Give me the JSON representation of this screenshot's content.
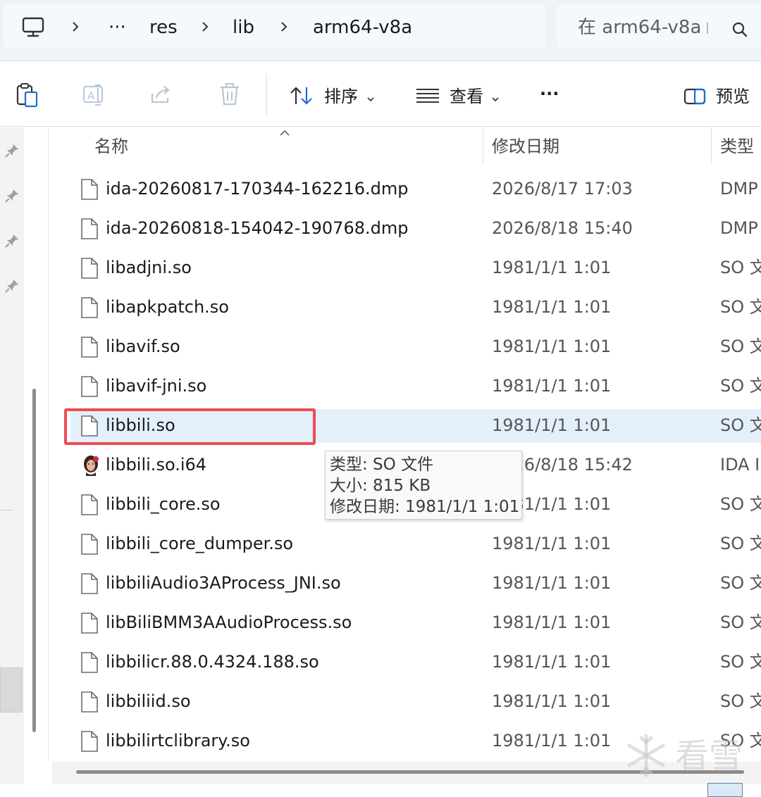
{
  "address_bar": {
    "breadcrumbs": [
      "res",
      "lib",
      "arm64-v8a"
    ],
    "overflow": "···"
  },
  "search": {
    "placeholder": "在 arm64-v8a"
  },
  "toolbar": {
    "sort_label": "排序",
    "view_label": "查看",
    "more_label": "···",
    "preview_label": "预览"
  },
  "columns": {
    "name": "名称",
    "modified": "修改日期",
    "type": "类型"
  },
  "files": [
    {
      "name": "ida-20260817-170344-162216.dmp",
      "modified": "2026/8/17 17:03",
      "type": "DMP",
      "icon": "file-icon"
    },
    {
      "name": "ida-20260818-154042-190768.dmp",
      "modified": "2026/8/18 15:40",
      "type": "DMP",
      "icon": "file-icon"
    },
    {
      "name": "libadjni.so",
      "modified": "1981/1/1 1:01",
      "type": "SO 文",
      "icon": "file-icon"
    },
    {
      "name": "libapkpatch.so",
      "modified": "1981/1/1 1:01",
      "type": "SO 文",
      "icon": "file-icon"
    },
    {
      "name": "libavif.so",
      "modified": "1981/1/1 1:01",
      "type": "SO 文",
      "icon": "file-icon"
    },
    {
      "name": "libavif-jni.so",
      "modified": "1981/1/1 1:01",
      "type": "SO 文",
      "icon": "file-icon"
    },
    {
      "name": "libbili.so",
      "modified": "1981/1/1 1:01",
      "type": "SO 文",
      "icon": "file-icon",
      "selected": true
    },
    {
      "name": "libbili.so.i64",
      "modified": "2026/8/18 15:42",
      "type": "IDA I",
      "icon": "ida-database-icon"
    },
    {
      "name": "libbili_core.so",
      "modified": "1981/1/1 1:01",
      "type": "SO 文",
      "icon": "file-icon"
    },
    {
      "name": "libbili_core_dumper.so",
      "modified": "1981/1/1 1:01",
      "type": "SO 文",
      "icon": "file-icon"
    },
    {
      "name": "libbiliAudio3AProcess_JNI.so",
      "modified": "1981/1/1 1:01",
      "type": "SO 文",
      "icon": "file-icon"
    },
    {
      "name": "libBiliBMM3AAudioProcess.so",
      "modified": "1981/1/1 1:01",
      "type": "SO 文",
      "icon": "file-icon"
    },
    {
      "name": "libbilicr.88.0.4324.188.so",
      "modified": "1981/1/1 1:01",
      "type": "SO 文",
      "icon": "file-icon"
    },
    {
      "name": "libbiliid.so",
      "modified": "1981/1/1 1:01",
      "type": "SO 文",
      "icon": "file-icon"
    },
    {
      "name": "libbilirtclibrary.so",
      "modified": "1981/1/1 1:01",
      "type": "SO 文",
      "icon": "file-icon"
    }
  ],
  "tooltip": {
    "type_line": "类型: SO 文件",
    "size_line": "大小: 815 KB",
    "modified_line": "修改日期: 1981/1/1 1:01"
  },
  "watermark": {
    "text": "看雪"
  },
  "colors": {
    "selection": "#e3f0fc",
    "highlight_border": "#ef4b55",
    "accent": "#0067c0"
  }
}
